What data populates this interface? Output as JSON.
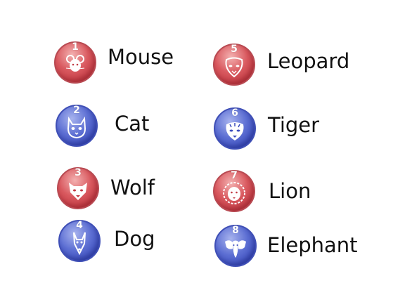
{
  "colors": {
    "red_badge": "#c94a52",
    "blue_badge": "#4b5cc8",
    "label_text": "#111111"
  },
  "animals": [
    {
      "number": "1",
      "name": "Mouse",
      "color": "red",
      "icon": "mouse-icon"
    },
    {
      "number": "2",
      "name": "Cat",
      "color": "blue",
      "icon": "cat-icon"
    },
    {
      "number": "3",
      "name": "Wolf",
      "color": "red",
      "icon": "wolf-icon"
    },
    {
      "number": "4",
      "name": "Dog",
      "color": "blue",
      "icon": "dog-icon"
    },
    {
      "number": "5",
      "name": "Leopard",
      "color": "red",
      "icon": "leopard-icon"
    },
    {
      "number": "6",
      "name": "Tiger",
      "color": "blue",
      "icon": "tiger-icon"
    },
    {
      "number": "7",
      "name": "Lion",
      "color": "red",
      "icon": "lion-icon"
    },
    {
      "number": "8",
      "name": "Elephant",
      "color": "blue",
      "icon": "elephant-icon"
    }
  ]
}
